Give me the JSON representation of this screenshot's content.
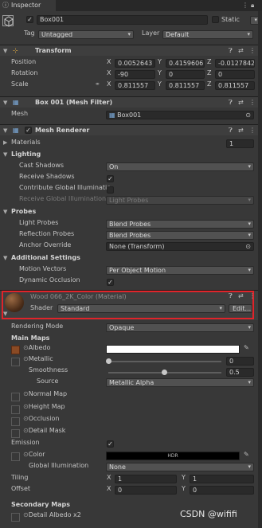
{
  "window": {
    "tab_title": "Inspector"
  },
  "header": {
    "object_name": "Box001",
    "static_label": "Static",
    "tag_label": "Tag",
    "tag_value": "Untagged",
    "layer_label": "Layer",
    "layer_value": "Default"
  },
  "transform": {
    "title": "Transform",
    "position_label": "Position",
    "rotation_label": "Rotation",
    "scale_label": "Scale",
    "position": {
      "x": "0.0052643",
      "y": "0.4159606",
      "z": "-0.0127842"
    },
    "rotation": {
      "x": "-90",
      "y": "0",
      "z": "0"
    },
    "scale": {
      "x": "0.811557",
      "y": "0.811557",
      "z": "0.811557"
    }
  },
  "mesh_filter": {
    "title": "Box 001 (Mesh Filter)",
    "mesh_label": "Mesh",
    "mesh_value": "Box001"
  },
  "mesh_renderer": {
    "title": "Mesh Renderer",
    "materials_label": "Materials",
    "materials_count": "1",
    "lighting_label": "Lighting",
    "cast_shadows_label": "Cast Shadows",
    "cast_shadows_value": "On",
    "receive_shadows_label": "Receive Shadows",
    "contribute_gi_label": "Contribute Global Illuminatio",
    "receive_gi_label": "Receive Global Illumination",
    "receive_gi_value": "Light Probes",
    "probes_label": "Probes",
    "light_probes_label": "Light Probes",
    "light_probes_value": "Blend Probes",
    "reflection_probes_label": "Reflection Probes",
    "reflection_probes_value": "Blend Probes",
    "anchor_override_label": "Anchor Override",
    "anchor_override_value": "None (Transform)",
    "additional_label": "Additional Settings",
    "motion_vectors_label": "Motion Vectors",
    "motion_vectors_value": "Per Object Motion",
    "dynamic_occlusion_label": "Dynamic Occlusion"
  },
  "material": {
    "title": "Wood 066_2K_Color (Material)",
    "shader_label": "Shader",
    "shader_value": "Standard",
    "edit_label": "Edit...",
    "rendering_mode_label": "Rendering Mode",
    "rendering_mode_value": "Opaque",
    "main_maps_label": "Main Maps",
    "albedo_label": "Albedo",
    "metallic_label": "Metallic",
    "metallic_value": "0",
    "smoothness_label": "Smoothness",
    "smoothness_value": "0.5",
    "source_label": "Source",
    "source_value": "Metallic Alpha",
    "normal_map_label": "Normal Map",
    "height_map_label": "Height Map",
    "occlusion_label": "Occlusion",
    "detail_mask_label": "Detail Mask",
    "emission_label": "Emission",
    "color_label": "Color",
    "hdr_label": "HDR",
    "global_illum_label": "Global Illumination",
    "global_illum_value": "None",
    "tiling_label": "Tiling",
    "tiling_x": "1",
    "tiling_y": "1",
    "offset_label": "Offset",
    "offset_x": "0",
    "offset_y": "0",
    "secondary_maps_label": "Secondary Maps",
    "detail_albedo_label": "Detail Albedo x2"
  },
  "watermark": "CSDN @wififi",
  "colors": {
    "highlight_border": "#e0242a",
    "panel": "#383838",
    "header": "#3e3e3e",
    "field": "#2a2a2a"
  }
}
